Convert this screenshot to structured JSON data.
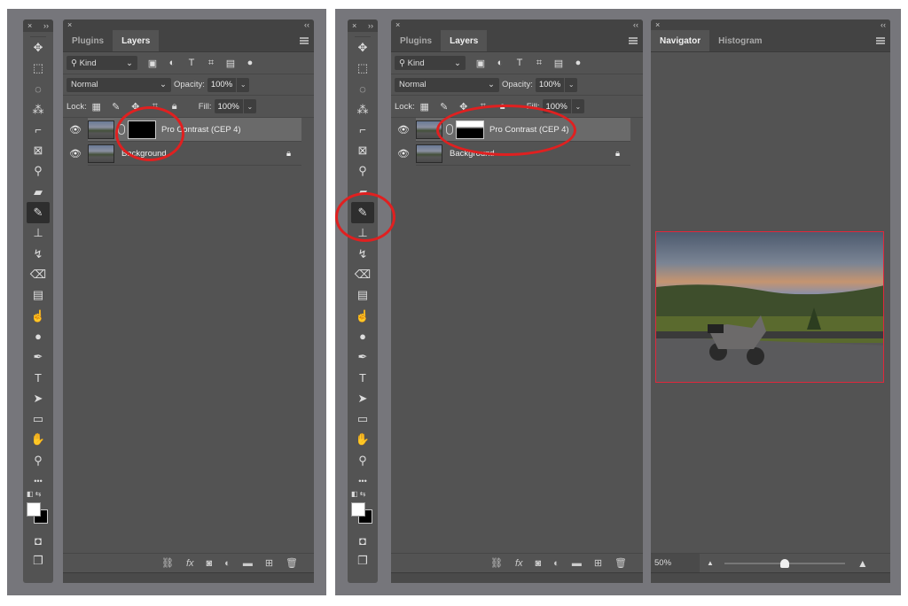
{
  "left": {
    "toolbar": {
      "close": "×",
      "expand": "››"
    },
    "panel": {
      "close": "×",
      "collapse": "‹‹",
      "tabs": [
        {
          "label": "Plugins",
          "active": false
        },
        {
          "label": "Layers",
          "active": true
        }
      ],
      "filter": {
        "label": "Kind",
        "icon": "search-icon"
      },
      "blend_mode": "Normal",
      "opacity_label": "Opacity:",
      "opacity": "100%",
      "lock_label": "Lock:",
      "fill_label": "Fill:",
      "fill": "100%",
      "layers": [
        {
          "name": "Pro Contrast (CEP 4)",
          "selected": true,
          "visible": true,
          "mask": "black"
        },
        {
          "name": "Background",
          "selected": false,
          "visible": true,
          "locked": true
        }
      ]
    }
  },
  "right": {
    "toolbar": {
      "close": "×",
      "expand": "››"
    },
    "panel": {
      "close": "×",
      "collapse": "‹‹",
      "tabs": [
        {
          "label": "Plugins",
          "active": false
        },
        {
          "label": "Layers",
          "active": true
        }
      ],
      "filter": {
        "label": "Kind",
        "icon": "search-icon"
      },
      "blend_mode": "Normal",
      "opacity_label": "Opacity:",
      "opacity": "100%",
      "lock_label": "Lock:",
      "fill_label": "Fill:",
      "fill": "100%",
      "layers": [
        {
          "name": "Pro Contrast (CEP 4)",
          "selected": true,
          "visible": true,
          "mask": "painted"
        },
        {
          "name": "Background",
          "selected": false,
          "visible": true,
          "locked": true
        }
      ]
    },
    "navigator": {
      "close": "×",
      "collapse": "‹‹",
      "tabs": [
        {
          "label": "Navigator",
          "active": true
        },
        {
          "label": "Histogram",
          "active": false
        }
      ],
      "zoom": "50%",
      "zoom_slider_fraction": 0.5,
      "preview_desc": "Motorcycle parked at mountain overlook at sunset"
    }
  },
  "tools": [
    "move",
    "marquee",
    "lasso",
    "magic-wand",
    "crop",
    "frame",
    "eyedropper",
    "healing",
    "brush",
    "stamp",
    "history-brush",
    "eraser",
    "gradient",
    "smudge",
    "dodge",
    "pen",
    "type",
    "path-select",
    "rectangle",
    "hand",
    "zoom",
    "more"
  ],
  "colors": {
    "accent_annotation": "#e02020",
    "panel": "#535353",
    "header": "#434343",
    "selected_layer": "#6a6a6a",
    "nav_frame": "#e0283c"
  }
}
